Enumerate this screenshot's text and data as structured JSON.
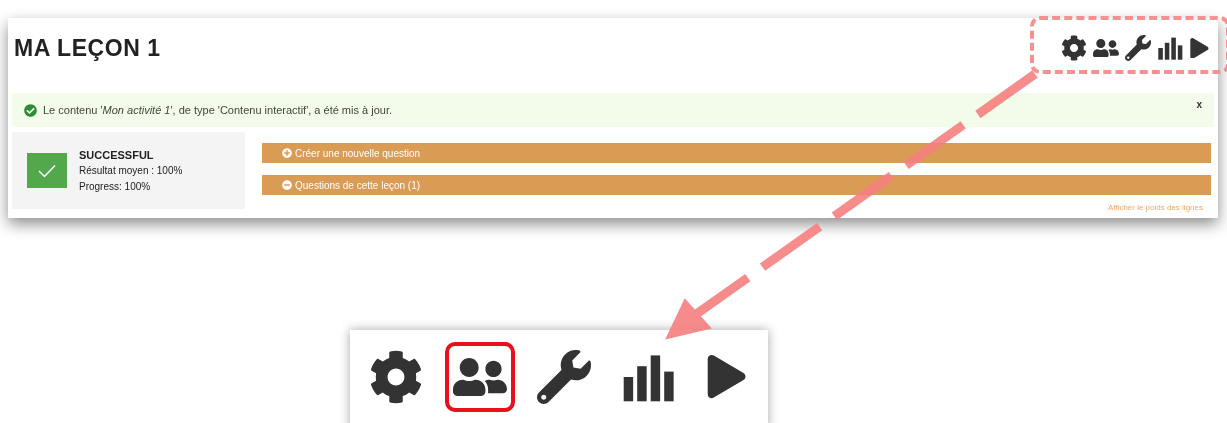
{
  "page": {
    "title": "MA LEÇON 1",
    "toolbar": [
      {
        "kind": "gear"
      },
      {
        "kind": "users"
      },
      {
        "kind": "wrench"
      },
      {
        "kind": "bars"
      },
      {
        "kind": "play"
      }
    ],
    "alert": {
      "text": "Le contenu '*Mon activité 1*', de type 'Contenu interactif', a été mis à jour.",
      "close": "x"
    },
    "status": {
      "heading": "SUCCESSFUL",
      "lines": [
        "Résultat moyen : 100%",
        "Progress: 100%"
      ]
    },
    "actions": [
      {
        "kind": "expand",
        "label": "Créer une nouvelle question"
      },
      {
        "kind": "collapse",
        "label": "Questions de cette leçon (1)"
      }
    ],
    "link": "Afficher le poids des lignes"
  },
  "zoom_inset": {
    "icons": [
      {
        "kind": "gear",
        "highlighted": false
      },
      {
        "kind": "users",
        "highlighted": true
      },
      {
        "kind": "wrench",
        "highlighted": false
      },
      {
        "kind": "bars",
        "highlighted": false
      },
      {
        "kind": "play",
        "highlighted": false
      }
    ]
  }
}
